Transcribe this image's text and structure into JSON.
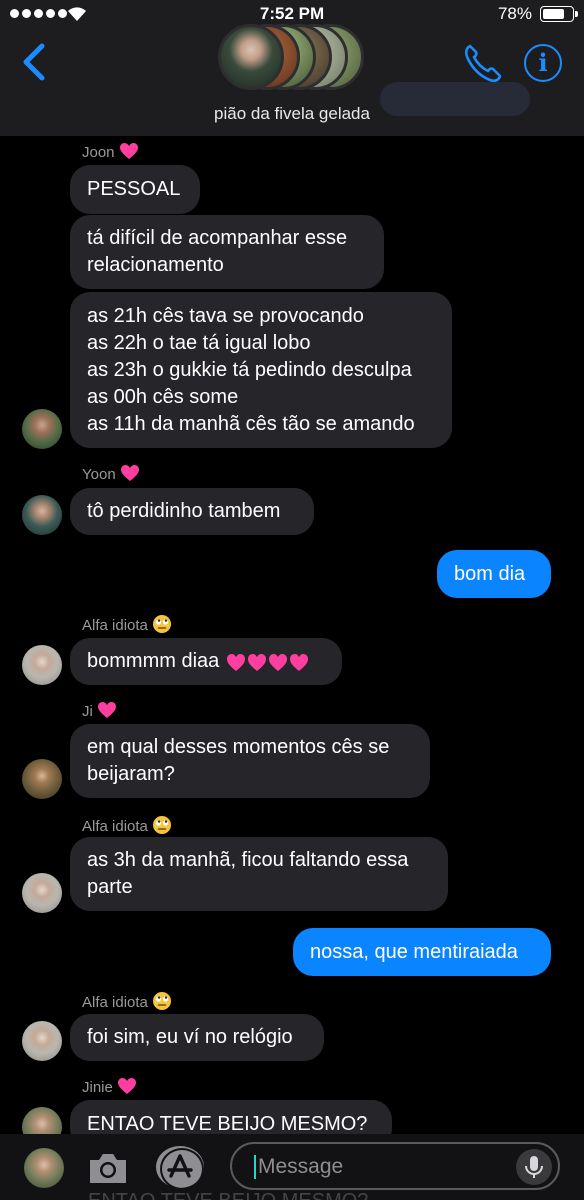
{
  "status": {
    "time": "7:52 PM",
    "battery": "78%",
    "battery_level": 0.78
  },
  "header": {
    "group_name": "pião da fivela gelada",
    "accent": "#1a8cff"
  },
  "messages": [
    {
      "sender": "Joon",
      "sender_emoji": "sparkling-heart",
      "texts": [
        "PESSOAL"
      ]
    },
    {
      "texts": [
        "tá difícil de acompanhar esse",
        "relacionamento"
      ]
    },
    {
      "texts": [
        "as 21h cês tava se provocando",
        "as 22h o tae tá igual lobo",
        "as 23h o gukkie tá pedindo desculpa",
        "as 00h cês some",
        "as 11h da manhã cês tão se amando"
      ]
    },
    {
      "sender": "Yoon",
      "sender_emoji": "sparkling-heart",
      "texts": [
        "tô perdidinho tambem"
      ]
    },
    {
      "texts": [
        "bom dia"
      ],
      "outgoing": true
    },
    {
      "sender": "Alfa idiota",
      "sender_emoji": "eye-roll",
      "texts": [
        "bommmm diaa"
      ]
    },
    {
      "sender": "Ji",
      "sender_emoji": "sparkling-heart",
      "texts": [
        "em qual desses momentos cês se",
        "beijaram?"
      ]
    },
    {
      "sender": "Alfa idiota",
      "sender_emoji": "eye-roll",
      "texts": [
        "as 3h da manhã, ficou faltando essa",
        "parte"
      ]
    },
    {
      "texts": [
        "nossa, que mentiraiada"
      ],
      "outgoing": true
    },
    {
      "sender": "Alfa idiota",
      "sender_emoji": "eye-roll",
      "texts": [
        "foi sim, eu ví no relógio"
      ]
    },
    {
      "sender": "Jinie",
      "sender_emoji": "sparkling-heart",
      "texts": [
        "ENTAO TEVE BEIJO MESMO?"
      ]
    }
  ],
  "composer": {
    "placeholder": "Message",
    "peek_text": "ENTAO TEVE BEIJO MESMO?"
  },
  "colors": {
    "incoming": "#26252a",
    "outgoing": "#0a84ff",
    "background": "#000000"
  }
}
